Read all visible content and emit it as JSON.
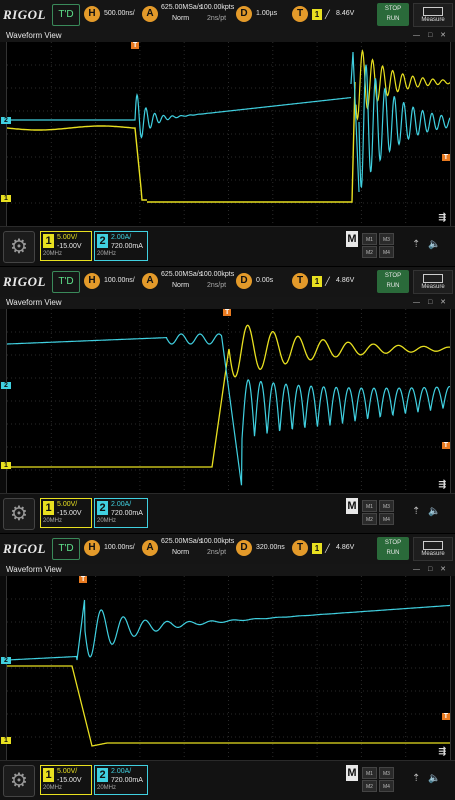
{
  "screens": [
    {
      "logo": "RIGOL",
      "mode": "T'D",
      "h_label": "H",
      "timebase": "500.00ns/",
      "a_label": "A",
      "sample_rate": "625.00MSa/s",
      "points": "100.00kpts",
      "acq_mode": "Norm",
      "pt_interval": "2ns/pt",
      "d_label": "D",
      "delay": "1.00µs",
      "t_label": "T",
      "trig_ch": "1",
      "trig_level": "8.46V",
      "stop_label": "STOP",
      "run_label": "RUN",
      "measure_label": "Measure",
      "window_title": "Waveform View",
      "ch1": {
        "num": "1",
        "scale": "5.00V/",
        "offset": "-15.00V",
        "bw": "20MHz"
      },
      "ch2": {
        "num": "2",
        "scale": "2.00A/",
        "offset": "720.00mA",
        "bw": "20MHz"
      },
      "math": "M",
      "mem": [
        "M1",
        "M2",
        "M3",
        "M4"
      ],
      "marker_1": "1",
      "marker_2": "2",
      "marker_t": "T"
    },
    {
      "logo": "RIGOL",
      "mode": "T'D",
      "h_label": "H",
      "timebase": "100.00ns/",
      "a_label": "A",
      "sample_rate": "625.00MSa/s",
      "points": "100.00kpts",
      "acq_mode": "Norm",
      "pt_interval": "2ns/pt",
      "d_label": "D",
      "delay": "0.00s",
      "t_label": "T",
      "trig_ch": "1",
      "trig_level": "4.86V",
      "stop_label": "STOP",
      "run_label": "RUN",
      "measure_label": "Measure",
      "window_title": "Waveform View",
      "ch1": {
        "num": "1",
        "scale": "5.00V/",
        "offset": "-15.00V",
        "bw": "20MHz"
      },
      "ch2": {
        "num": "2",
        "scale": "2.00A/",
        "offset": "720.00mA",
        "bw": "20MHz"
      },
      "math": "M",
      "mem": [
        "M1",
        "M2",
        "M3",
        "M4"
      ],
      "marker_1": "1",
      "marker_2": "2",
      "marker_t": "T"
    },
    {
      "logo": "RIGOL",
      "mode": "T'D",
      "h_label": "H",
      "timebase": "100.00ns/",
      "a_label": "A",
      "sample_rate": "625.00MSa/s",
      "points": "100.00kpts",
      "acq_mode": "Norm",
      "pt_interval": "2ns/pt",
      "d_label": "D",
      "delay": "320.00ns",
      "t_label": "T",
      "trig_ch": "1",
      "trig_level": "4.86V",
      "stop_label": "STOP",
      "run_label": "RUN",
      "measure_label": "Measure",
      "window_title": "Waveform View",
      "ch1": {
        "num": "1",
        "scale": "5.00V/",
        "offset": "-15.00V",
        "bw": "20MHz"
      },
      "ch2": {
        "num": "2",
        "scale": "2.00A/",
        "offset": "720.00mA",
        "bw": "20MHz"
      },
      "math": "M",
      "mem": [
        "M1",
        "M2",
        "M3",
        "M4"
      ],
      "marker_1": "1",
      "marker_2": "2",
      "marker_t": "T"
    }
  ],
  "colors": {
    "ch1": "#e8e020",
    "ch2": "#40d0e0",
    "trigger": "#e87a20",
    "accent_green": "#5ee08a",
    "run_green": "#2a6a3a"
  },
  "icons": {
    "gear": "gear-icon",
    "usb": "usb-icon",
    "speaker": "speaker-icon",
    "expand": "expand-icon"
  }
}
